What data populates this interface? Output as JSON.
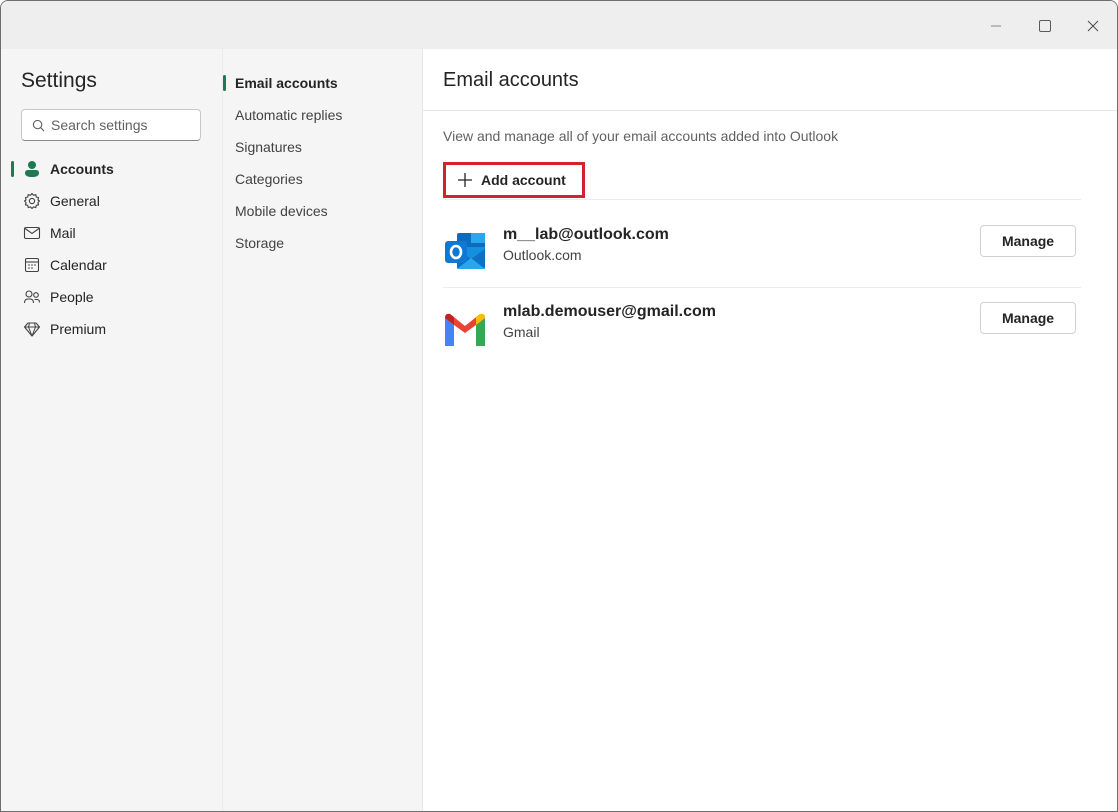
{
  "window": {
    "controls": {
      "minimize": "minimize-icon",
      "maximize": "maximize-icon",
      "close": "close-icon"
    }
  },
  "sidebar": {
    "title": "Settings",
    "search": {
      "placeholder": "Search settings",
      "value": ""
    },
    "items": [
      {
        "label": "Accounts",
        "icon": "person-icon",
        "active": true
      },
      {
        "label": "General",
        "icon": "gear-icon",
        "active": false
      },
      {
        "label": "Mail",
        "icon": "mail-icon",
        "active": false
      },
      {
        "label": "Calendar",
        "icon": "calendar-icon",
        "active": false
      },
      {
        "label": "People",
        "icon": "people-icon",
        "active": false
      },
      {
        "label": "Premium",
        "icon": "diamond-icon",
        "active": false
      }
    ]
  },
  "subnav": {
    "items": [
      {
        "label": "Email accounts",
        "active": true
      },
      {
        "label": "Automatic replies",
        "active": false
      },
      {
        "label": "Signatures",
        "active": false
      },
      {
        "label": "Categories",
        "active": false
      },
      {
        "label": "Mobile devices",
        "active": false
      },
      {
        "label": "Storage",
        "active": false
      }
    ]
  },
  "main": {
    "title": "Email accounts",
    "description": "View and manage all of your email accounts added into Outlook",
    "add_account_label": "Add account",
    "accounts": [
      {
        "email": "m__lab@outlook.com",
        "type": "Outlook.com",
        "icon": "outlook-logo-icon",
        "manage_label": "Manage"
      },
      {
        "email": "mlab.demouser@gmail.com",
        "type": "Gmail",
        "icon": "gmail-logo-icon",
        "manage_label": "Manage"
      }
    ]
  },
  "colors": {
    "accent": "#1e7a52",
    "highlight_border": "#d3212d"
  }
}
